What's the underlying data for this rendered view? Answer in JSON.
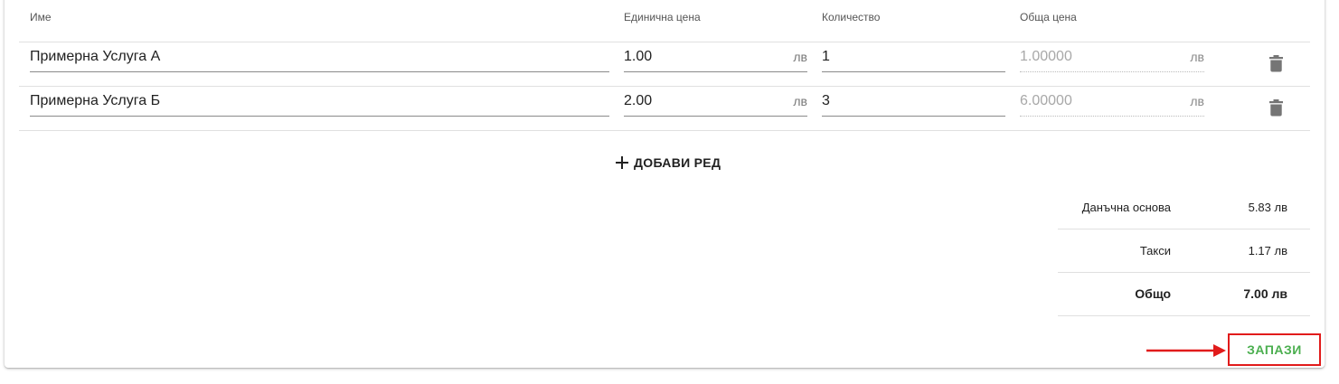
{
  "table": {
    "headers": {
      "name": "Име",
      "unit_price": "Единична цена",
      "quantity": "Количество",
      "total_price": "Обща цена"
    },
    "currency": "лв",
    "rows": [
      {
        "name": "Примерна Услуга А",
        "unit_price": "1.00",
        "quantity": "1",
        "total": "1.00000"
      },
      {
        "name": "Примерна Услуга Б",
        "unit_price": "2.00",
        "quantity": "3",
        "total": "6.00000"
      }
    ]
  },
  "add_row_label": "ДОБАВИ РЕД",
  "summary": {
    "tax_base_label": "Данъчна основа",
    "tax_base_value": "5.83 лв",
    "taxes_label": "Такси",
    "taxes_value": "1.17 лв",
    "total_label": "Общо",
    "total_value": "7.00 лв"
  },
  "save_label": "ЗАПАЗИ",
  "colors": {
    "save_text": "#4caf50",
    "highlight_border": "#e11b1b",
    "annotation_arrow": "#e11b1b"
  }
}
